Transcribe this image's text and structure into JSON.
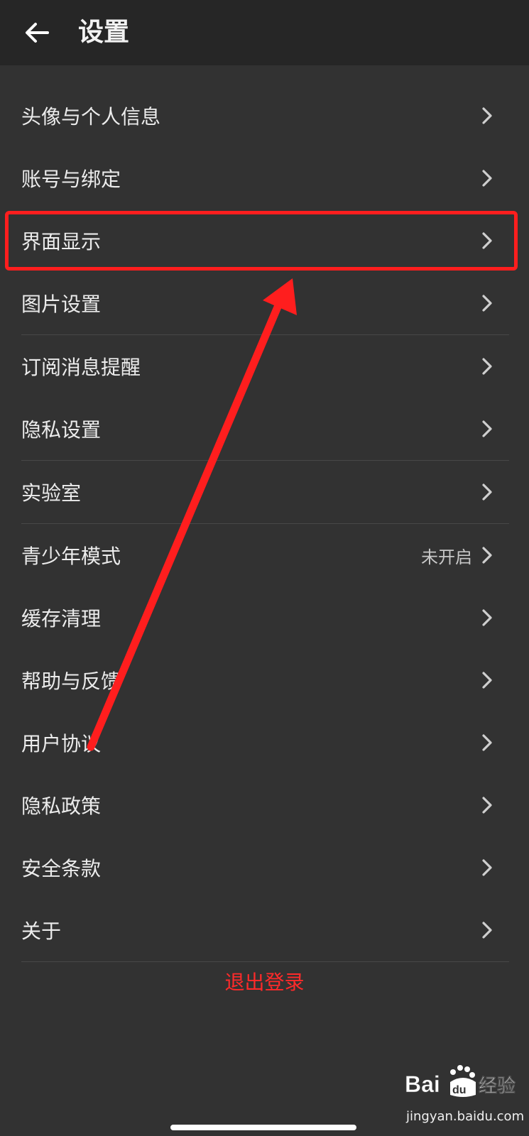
{
  "header": {
    "back_icon": "arrow-left-icon",
    "title": "设置"
  },
  "menu": [
    {
      "label": "头像与个人信息",
      "value": ""
    },
    {
      "label": "账号与绑定",
      "value": ""
    },
    {
      "label": "界面显示",
      "value": ""
    },
    {
      "label": "图片设置",
      "value": ""
    },
    {
      "label": "订阅消息提醒",
      "value": ""
    },
    {
      "label": "隐私设置",
      "value": ""
    },
    {
      "label": "实验室",
      "value": ""
    },
    {
      "label": "青少年模式",
      "value": "未开启"
    },
    {
      "label": "缓存清理",
      "value": ""
    },
    {
      "label": "帮助与反馈",
      "value": ""
    },
    {
      "label": "用户协议",
      "value": ""
    },
    {
      "label": "隐私政策",
      "value": ""
    },
    {
      "label": "安全条款",
      "value": ""
    },
    {
      "label": "关于",
      "value": ""
    }
  ],
  "logout_label": "退出登录",
  "watermark": {
    "site": "jingyan.baidu.com",
    "logo_text": "Bai",
    "logo_du": "du",
    "logo_suffix": "经验"
  },
  "colors": {
    "background": "#323232",
    "header": "#262626",
    "logout": "#ff2a2a",
    "annotation": "#ff1e1e"
  }
}
